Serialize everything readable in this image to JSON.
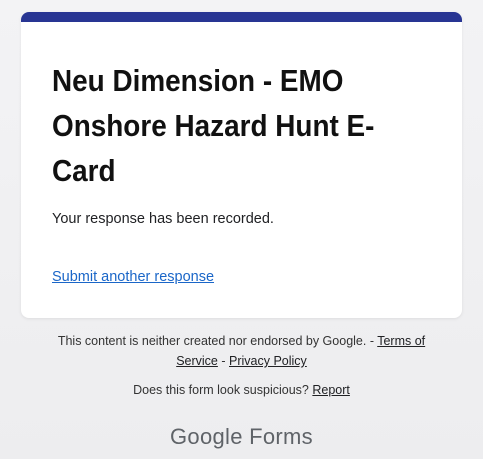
{
  "form": {
    "title": "Neu Dimension - EMO Onshore Hazard Hunt E-Card",
    "confirmation": "Your response has been recorded.",
    "submit_another": "Submit another response",
    "accent_color": "#283593"
  },
  "footer": {
    "disclaimer": "This content is neither created nor endorsed by Google. -",
    "terms": "Terms of Service",
    "separator": "-",
    "privacy": "Privacy Policy",
    "suspicious_question": "Does this form look suspicious?",
    "report": "Report",
    "brand": "Google Forms"
  }
}
